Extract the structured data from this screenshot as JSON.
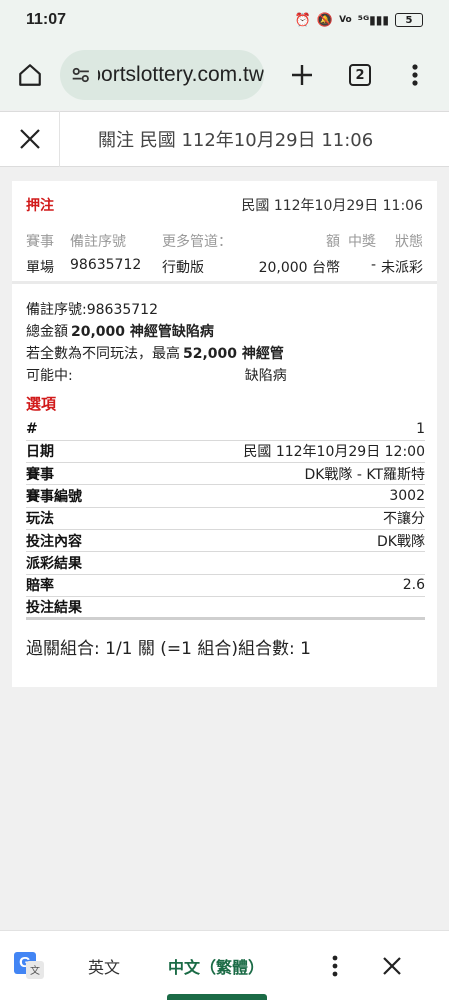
{
  "status_bar": {
    "time": "11:07",
    "icons": [
      "alarm-icon",
      "mute-icon",
      "volte-icon",
      "5g-signal-icon"
    ],
    "battery": "5"
  },
  "browser": {
    "url_text": "sportslottery.com.tw",
    "tab_count": "2"
  },
  "header": {
    "title": "關注 民國 112年10月29日 11:06"
  },
  "bet": {
    "label": "押注",
    "datetime": "民國 112年10月29日 11:06",
    "columns": [
      "賽事",
      "備註序號",
      "更多管道：",
      "額",
      "中獎",
      "狀態"
    ],
    "values": [
      "單場",
      "98635712",
      "行動版",
      "20,000 台幣",
      "-",
      "未派彩"
    ]
  },
  "details": {
    "serial": "備註序號:98635712",
    "total_prefix": "總金額",
    "total_amount": "20,000 神經管缺陷病",
    "max_prefix": "若全數為不同玩法，最高",
    "max_amount": "52,000 神經管",
    "possible_label": "可能中:",
    "possible_value": "缺陷病"
  },
  "options": {
    "title": "選項",
    "rows": [
      {
        "key": "#",
        "value": "1"
      },
      {
        "key": "日期",
        "value": "民國 112年10月29日 12:00"
      },
      {
        "key": "賽事",
        "value": "DK戰隊 - KT羅斯特"
      },
      {
        "key": "賽事編號",
        "value": "3002"
      },
      {
        "key": "玩法",
        "value": "不讓分"
      },
      {
        "key": "投注內容",
        "value": "DK戰隊"
      },
      {
        "key": "派彩結果",
        "value": ""
      },
      {
        "key": "賠率",
        "value": "2.6"
      },
      {
        "key": "投注結果",
        "value": ""
      }
    ],
    "combo": "過關組合: 1/1 關 (=1 組合)組合數: 1"
  },
  "translate_bar": {
    "lang_en": "英文",
    "lang_zh": "中文（繁體）",
    "accent": "#1b6b46"
  },
  "colors": {
    "accent_red": "#d11a1a",
    "chrome_bg": "#eef3f0"
  }
}
